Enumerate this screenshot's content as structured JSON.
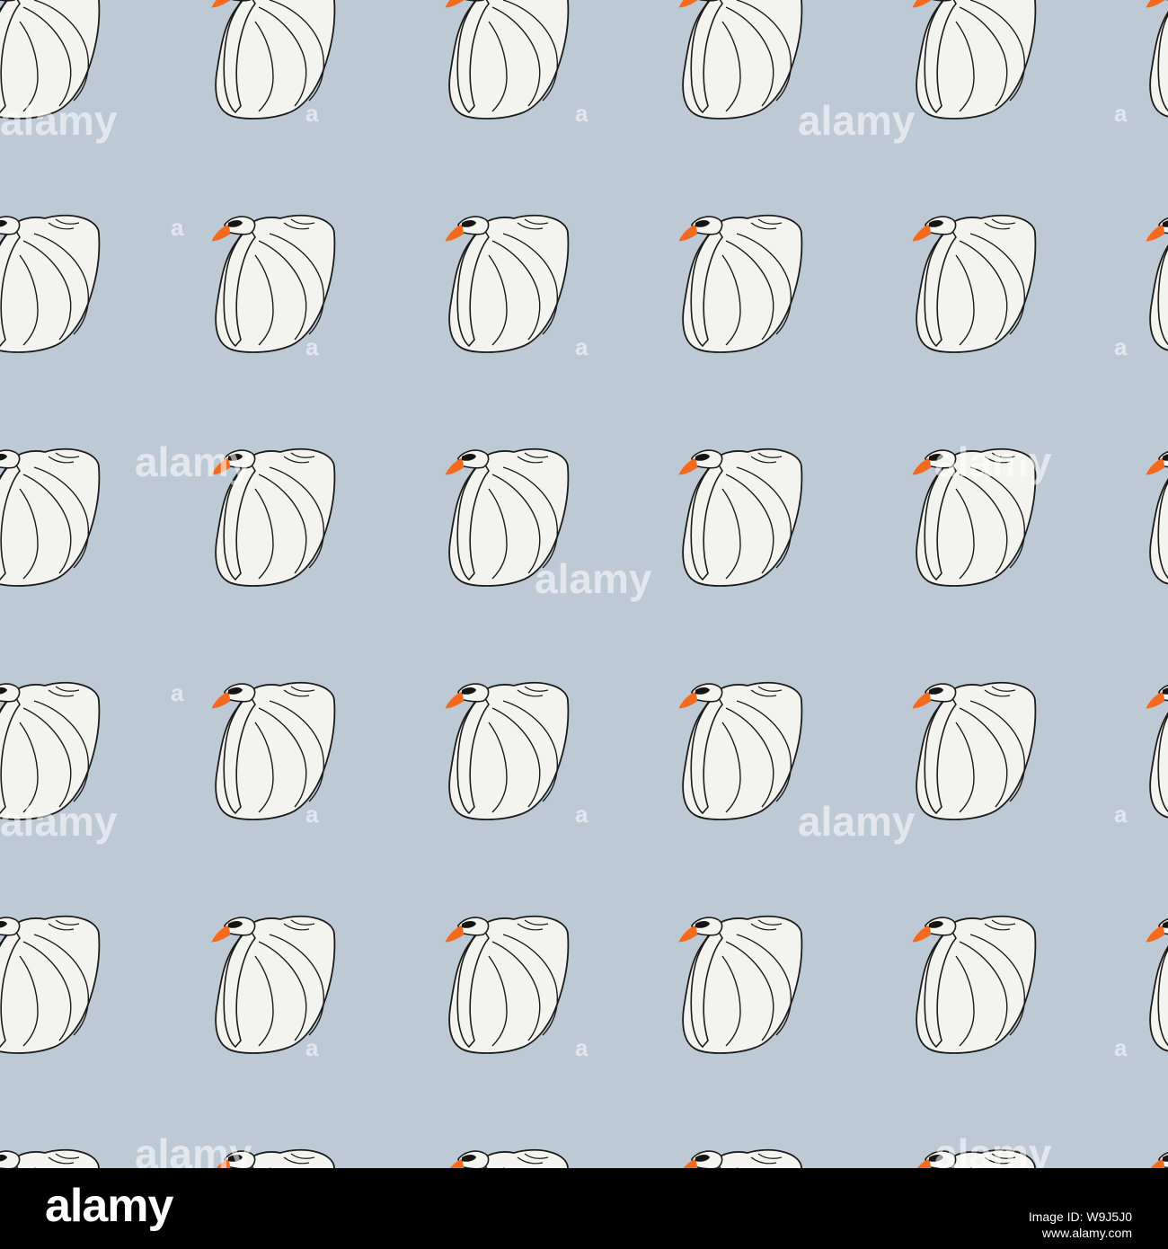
{
  "image": {
    "subject": "swan",
    "background_color": "#bdcad5",
    "swan_body_color": "#f3f4ef",
    "swan_outline_color": "#1b1b1b",
    "beak_color": "#f36a1f",
    "eye_mask_color": "#141414"
  },
  "watermark": {
    "word": "alamy",
    "letter": "a"
  },
  "footer": {
    "logo": "alamy",
    "image_id": "Image ID: W9J5J0",
    "site": "www.alamy.com",
    "background_color": "#000000",
    "text_color": "#ffffff"
  }
}
